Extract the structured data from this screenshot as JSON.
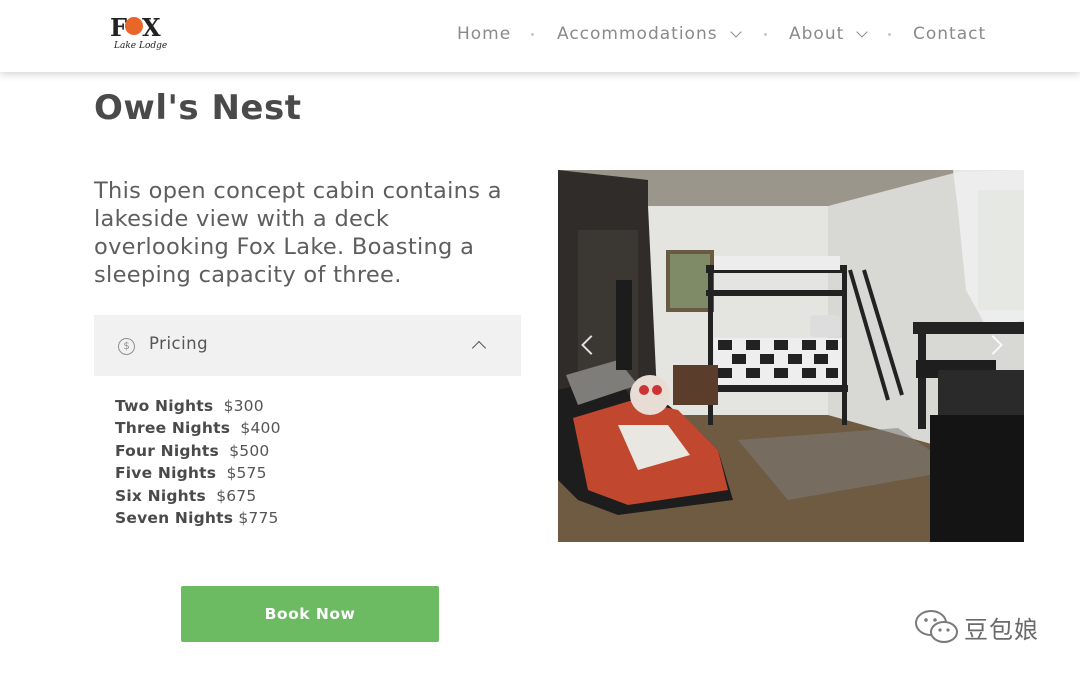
{
  "header": {
    "logo": {
      "name": "FOX",
      "tagline": "Lake Lodge"
    },
    "nav": [
      {
        "label": "Home",
        "has_dropdown": false
      },
      {
        "label": "Accommodations",
        "has_dropdown": true
      },
      {
        "label": "About",
        "has_dropdown": true
      },
      {
        "label": "Contact",
        "has_dropdown": false
      }
    ]
  },
  "page": {
    "title": "Owl's Nest",
    "description_lines": [
      "This open concept cabin contains a",
      "lakeside view with a deck",
      "overlooking Fox Lake. Boasting a",
      "sleeping capacity of three."
    ]
  },
  "pricing": {
    "label": "Pricing",
    "icon": "dollar-circle-icon",
    "expanded": true,
    "rows": [
      {
        "nights": "Two Nights",
        "price": "$300"
      },
      {
        "nights": "Three Nights",
        "price": "$400"
      },
      {
        "nights": "Four Nights",
        "price": "$500"
      },
      {
        "nights": "Five Nights",
        "price": "$575"
      },
      {
        "nights": "Six Nights",
        "price": "$675"
      },
      {
        "nights": "Seven Nights",
        "price": "$775"
      }
    ]
  },
  "book_button": {
    "label": "Book Now",
    "color": "#6cba62"
  },
  "carousel": {
    "image": "cabin-interior-photo",
    "prev_icon": "chevron-left-icon",
    "next_icon": "chevron-right-icon"
  },
  "watermark": {
    "text": "豆包娘",
    "icon": "wechat-icon"
  },
  "colors": {
    "logo_accent": "#e8662a",
    "nav_text": "#8a8a8a",
    "accordion_bg": "#f1f1f1"
  }
}
